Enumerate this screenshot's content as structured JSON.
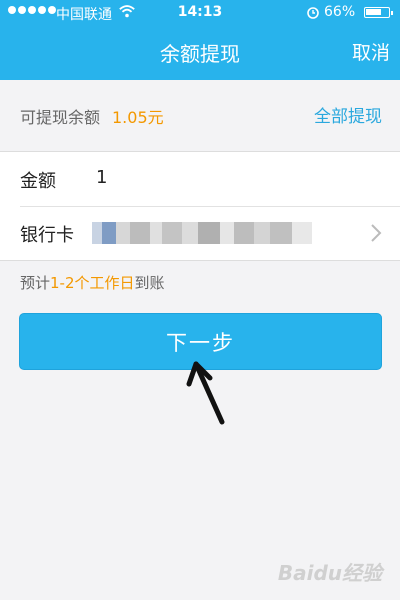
{
  "status_bar": {
    "carrier": "中国联通",
    "time": "14:13",
    "battery": "66%"
  },
  "nav": {
    "title": "余额提现",
    "cancel_label": "取消"
  },
  "balance": {
    "label": "可提现余额",
    "amount": "1.05元",
    "withdraw_all_label": "全部提现"
  },
  "form": {
    "amount_label": "金额",
    "amount_value": "1",
    "card_label": "银行卡"
  },
  "eta": {
    "prefix": "预计",
    "highlight": "1-2个工作日",
    "suffix": "到账"
  },
  "next_button_label": "下一步",
  "watermark": "Baidu经验",
  "colors": {
    "accent": "#28b3ec",
    "amount": "#f39800",
    "link": "#2aa8de"
  }
}
